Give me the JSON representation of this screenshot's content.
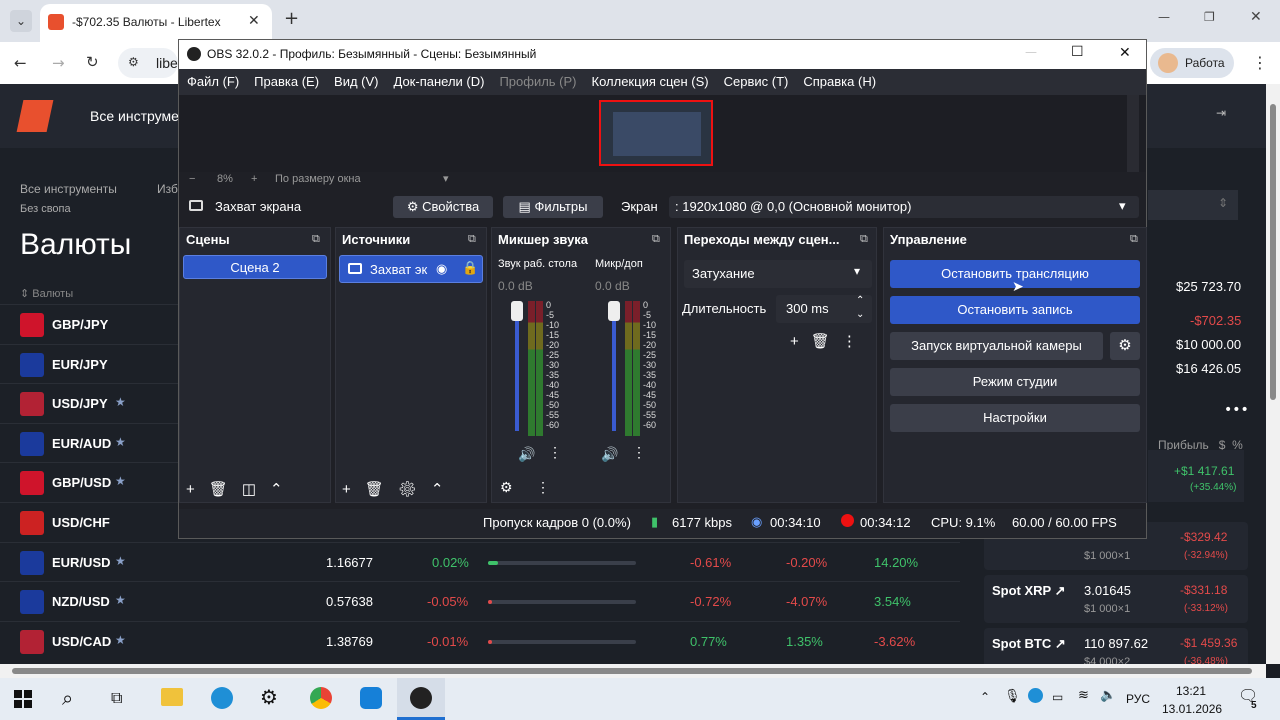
{
  "browser": {
    "tab_title": "-$702.35 Валюты - Libertex",
    "url_text": "liber",
    "profile": "Работа"
  },
  "site": {
    "brand_text": "Все инструме",
    "nav": {
      "all": "Все инструменты",
      "fav": "Изб",
      "collapse": "Без свопа"
    },
    "page_title": "Валюты",
    "sort_label": "Валюты",
    "balance": {
      "total": "$25 723.70",
      "pnl": "-$702.35",
      "invested": "$10 000.00",
      "available": "$16 426.05"
    },
    "profit_header": {
      "label": "Прибыль",
      "dollar": "$",
      "pct": "%"
    },
    "rows": [
      {
        "name": "GBP/JPY",
        "star": ""
      },
      {
        "name": "EUR/JPY",
        "star": ""
      },
      {
        "name": "USD/JPY",
        "star": "★"
      },
      {
        "name": "EUR/AUD",
        "star": "★"
      },
      {
        "name": "GBP/USD",
        "star": "★"
      },
      {
        "name": "USD/CHF",
        "star": ""
      },
      {
        "name": "EUR/USD",
        "star": "★",
        "price": "1.16677",
        "chg": "0.02%",
        "d1": "-0.61%",
        "d2": "-0.20%",
        "d3": "14.20%"
      },
      {
        "name": "NZD/USD",
        "star": "★",
        "price": "0.57638",
        "chg": "-0.05%",
        "d1": "-0.72%",
        "d2": "-4.07%",
        "d3": "3.54%"
      },
      {
        "name": "USD/CAD",
        "star": "★",
        "price": "1.38769",
        "chg": "-0.01%",
        "d1": "0.77%",
        "d2": "1.35%",
        "d3": "-3.62%"
      }
    ],
    "positions": [
      {
        "name": "",
        "price": "",
        "sub": "$1 000×1",
        "pnl": "-$329.42",
        "pct": "(-32.94%)"
      },
      {
        "name": "Spot XRP ↗",
        "price": "3.01645",
        "sub": "$1 000×1",
        "pnl": "-$331.18",
        "pct": "(-33.12%)"
      },
      {
        "name": "Spot BTC ↗",
        "price": "110 897.62",
        "sub": "$4 000×2",
        "pnl": "-$1 459.36",
        "pct": "(-36.48%)"
      }
    ],
    "first_position": {
      "pnl": "+$1 417.61",
      "pct": "(+35.44%)"
    }
  },
  "obs": {
    "title": "OBS 32.0.2 - Профиль: Безымянный - Сцены: Безымянный",
    "menu": [
      "Файл (F)",
      "Правка (E)",
      "Вид (V)",
      "Док-панели (D)",
      "Профиль (P)",
      "Коллекция сцен (S)",
      "Сервис (T)",
      "Справка (H)"
    ],
    "zoom": {
      "minus": "−",
      "value": "8%",
      "plus": "+",
      "fit": "По размеру окна"
    },
    "source_bar": {
      "name": "Захват экрана",
      "props": "Свойства",
      "filters": "Фильтры",
      "screen_label": "Экран",
      "screen_value": ": 1920x1080 @ 0,0 (Основной монитор)"
    },
    "scenes": {
      "title": "Сцены",
      "items": [
        "Сцена 2"
      ]
    },
    "sources": {
      "title": "Источники",
      "items": [
        "Захват эк"
      ]
    },
    "mixer": {
      "title": "Микшер звука",
      "channels": [
        {
          "name": "Звук раб. стола",
          "db": "0.0 dB"
        },
        {
          "name": "Микр/доп",
          "db": "0.0 dB"
        }
      ],
      "ticks": [
        "0",
        "-5",
        "-10",
        "-15",
        "-20",
        "-25",
        "-30",
        "-35",
        "-40",
        "-45",
        "-50",
        "-55",
        "-60"
      ]
    },
    "transitions": {
      "title": "Переходы между сцен...",
      "type": "Затухание",
      "duration_label": "Длительность",
      "duration": "300 ms"
    },
    "controls": {
      "title": "Управление",
      "stop_stream": "Остановить трансляцию",
      "stop_record": "Остановить запись",
      "virtual_cam": "Запуск виртуальной камеры",
      "studio": "Режим студии",
      "settings": "Настройки"
    },
    "status": {
      "dropped": "Пропуск кадров 0 (0.0%)",
      "bitrate": "6177 kbps",
      "stream_time": "00:34:10",
      "rec_time": "00:34:12",
      "cpu": "CPU: 9.1%",
      "fps": "60.00 / 60.00 FPS"
    }
  },
  "taskbar": {
    "lang": "РУС",
    "time": "13:21",
    "date": "13.01.2026",
    "notif": "5"
  }
}
